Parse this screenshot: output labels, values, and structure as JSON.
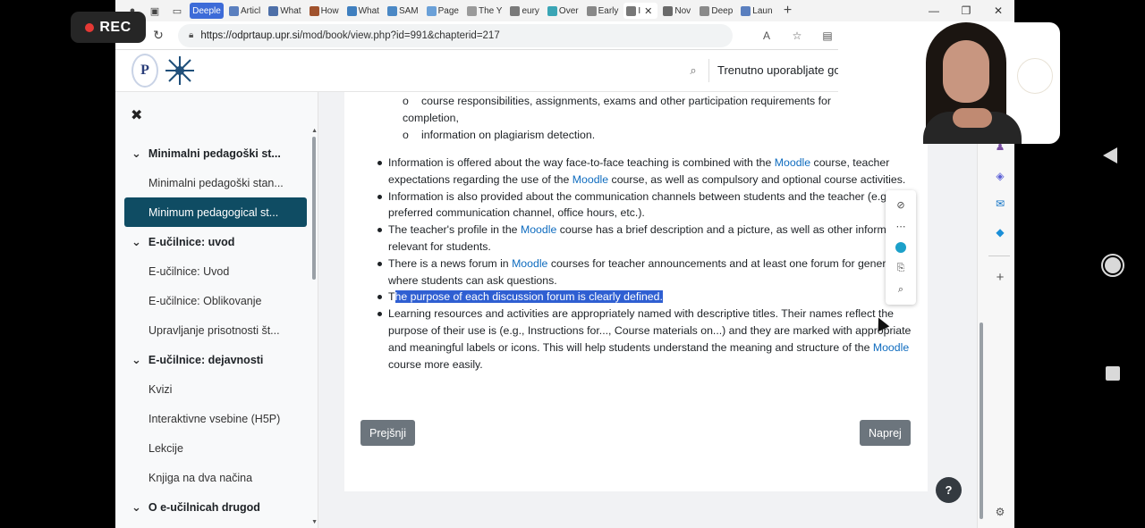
{
  "recorder": {
    "label": "REC"
  },
  "browser": {
    "tabs": [
      {
        "label": "Deeple",
        "kind": "deeple"
      },
      {
        "label": "Articl"
      },
      {
        "label": "What"
      },
      {
        "label": "How"
      },
      {
        "label": "What"
      },
      {
        "label": "SAM"
      },
      {
        "label": "Page"
      },
      {
        "label": "The Y"
      },
      {
        "label": "eury"
      },
      {
        "label": "Over"
      },
      {
        "label": "Early"
      },
      {
        "label": "I",
        "active": true
      },
      {
        "label": "Nov"
      },
      {
        "label": "Deep"
      },
      {
        "label": "Laun"
      }
    ],
    "url": {
      "host": "https://odprtaup.upr.si",
      "path": "/mod/book/view.php?id=991&chapterid=217"
    },
    "new_tab_symbol": "+",
    "window_controls": {
      "minimize": "—",
      "maximize": "❐",
      "close": "✕"
    }
  },
  "header": {
    "logo_letter": "P",
    "user_text": "Trenutno uporabljate gos"
  },
  "drawer": {
    "close_symbol": "✖",
    "items": [
      {
        "type": "section",
        "label": "Minimalni pedagoški st..."
      },
      {
        "type": "sub",
        "label": "Minimalni pedagoški stan..."
      },
      {
        "type": "sub",
        "label": "Minimum pedagogical st...",
        "active": true
      },
      {
        "type": "section",
        "label": "E-učilnice: uvod"
      },
      {
        "type": "sub",
        "label": "E-učilnice: Uvod"
      },
      {
        "type": "sub",
        "label": "E-učilnice: Oblikovanje"
      },
      {
        "type": "sub",
        "label": "Upravljanje prisotnosti št..."
      },
      {
        "type": "section",
        "label": "E-učilnice: dejavnosti"
      },
      {
        "type": "sub",
        "label": "Kvizi"
      },
      {
        "type": "sub",
        "label": "Interaktivne vsebine (H5P)"
      },
      {
        "type": "sub",
        "label": "Lekcije"
      },
      {
        "type": "sub",
        "label": "Knjiga na dva načina"
      },
      {
        "type": "section",
        "label": "O e-učilnicah drugod"
      }
    ]
  },
  "content": {
    "sublist": [
      {
        "marker": "o",
        "text": "course responsibilities, assignments, exams and other participation requirements for"
      },
      {
        "marker": "",
        "text": "completion,"
      },
      {
        "marker": "o",
        "text": "information on plagiarism detection."
      }
    ],
    "bullets": [
      {
        "parts": [
          {
            "t": "Information is offered about the way face-to-face teaching is combined with the "
          },
          {
            "t": "Moodle",
            "link": true
          },
          {
            "t": " course, teacher expectations regarding the use of the "
          },
          {
            "t": "Moodle",
            "link": true
          },
          {
            "t": " course, as well as compulsory and optional course activities."
          }
        ]
      },
      {
        "parts": [
          {
            "t": "Information is also provided about the communication channels between students and the teacher (e.g., preferred communication channel, office hours, etc.)."
          }
        ]
      },
      {
        "parts": [
          {
            "t": "The teacher's profile in the "
          },
          {
            "t": "Moodle",
            "link": true
          },
          {
            "t": " course has a brief description and a picture, as well as other information relevant for students."
          }
        ]
      },
      {
        "parts": [
          {
            "t": "There is a news forum in "
          },
          {
            "t": "Moodle",
            "link": true
          },
          {
            "t": " courses for teacher announcements and at least one forum for general use where students can ask questions."
          }
        ]
      },
      {
        "parts": [
          {
            "t": "T"
          },
          {
            "t": "he purpose of each discussion forum is clearly defined.",
            "selected": true
          }
        ]
      },
      {
        "parts": [
          {
            "t": "Learning resources and activities are appropriately named with descriptive titles. Their names reflect the purpose of their use is (e.g., Instructions for..., Course materials on...) and they are marked with appropriate and meaningful labels or icons. This will help students understand the meaning and structure of the "
          },
          {
            "t": "Moodle",
            "link": true
          },
          {
            "t": " course more easily."
          }
        ]
      }
    ],
    "prev_label": "Prejšnji",
    "next_label": "Naprej"
  },
  "help_label": "?",
  "colors": {
    "accent_active": "#0f4c63",
    "link": "#0f6cbf",
    "selection": "#2f5fd2",
    "button": "#6c757d"
  }
}
